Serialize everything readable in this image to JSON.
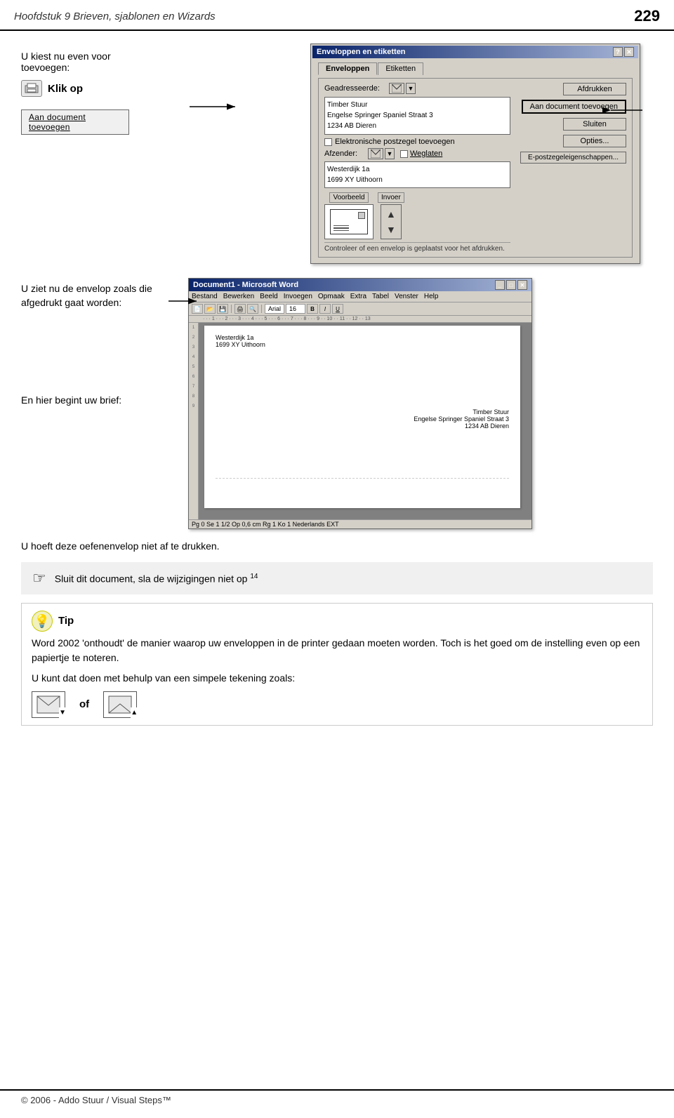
{
  "header": {
    "title": "Hoofdstuk 9 Brieven, sjablonen en Wizards",
    "page_number": "229"
  },
  "section1": {
    "intro_text1": "U kiest nu even voor toevoegen:",
    "klik_op": "Klik op",
    "btn_label": "Aan document toevoegen",
    "dialog_title": "Enveloppen en etiketten",
    "tab1": "Enveloppen",
    "tab2": "Etiketten",
    "label_geadresseerde": "Geadresseerde:",
    "recipient_text": "Timber Stuur\nEngelse Springer Spaniel Straat 3\n1234 AB Dieren",
    "btn_afdrukken": "Afdrukken",
    "btn_aan_doc": "Aan document toevoegen",
    "btn_sluiten": "Sluiten",
    "btn_opties": "Opties...",
    "btn_epost": "E-postzegeleigenschappen...",
    "checkbox_elektronisch": "Elektronische postzegel toevoegen",
    "label_afzender": "Afzender:",
    "label_weglaten": "Weglaten",
    "afzender_text": "Westerdijk 1a\n1699 XY Uithoorn",
    "label_voorbeeld": "Voorbeeld",
    "label_invoer": "Invoer",
    "note": "Controleer of een envelop is geplaatst voor het afdrukken."
  },
  "section2": {
    "text1": "U ziet nu de envelop zoals die afgedrukt gaat worden:",
    "text2": "En hier begint uw brief:",
    "word_title": "Document1 - Microsoft Word",
    "sender_line1": "Westerdijk 1a",
    "sender_line2": "1699 XY Uithoorn",
    "recipient_line1": "Timber Stuur",
    "recipient_line2": "Engelse Springer Spaniel Straat 3",
    "recipient_line3": "1234 AB Dieren",
    "statusbar": "Pg 0   Se 1   1/2   Op 0,6 cm   Rg 1   Ko 1   Nederlands   EXT"
  },
  "section3": {
    "text": "U hoeft deze oefenenvelop niet af te drukken."
  },
  "instruction": {
    "icon": "☞",
    "text": "Sluit dit document, sla de wijzigingen niet op",
    "superscript": "14"
  },
  "tip": {
    "title": "Tip",
    "text1": "Word 2002 'onthoudt' de manier waarop uw enveloppen in de printer gedaan moeten worden. Toch is het goed om de instelling even op een papiertje te noteren.",
    "text2": "U kunt dat doen met behulp van een simpele tekening zoals:",
    "of_text": "of"
  },
  "footer": {
    "copyright": "© 2006 - Addo Stuur / Visual Steps™"
  }
}
